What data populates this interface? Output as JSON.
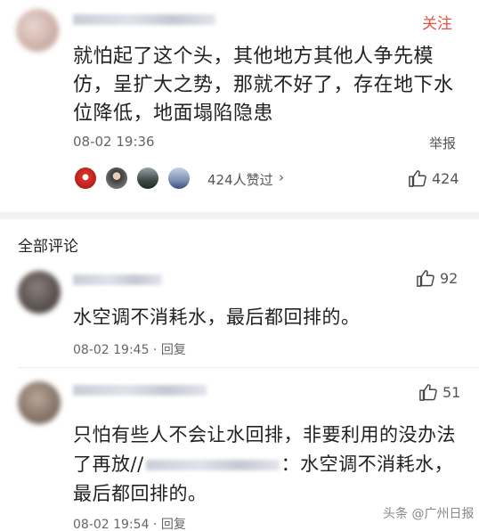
{
  "top_comment": {
    "follow_label": "关注",
    "text": "就怕起了这个头，其他地方其他人争先模仿，呈扩大之势，那就不好了，存在地下水位降低，地面塌陷隐患",
    "time": "08-02 19:36",
    "report_label": "举报",
    "likers_label": "424人赞过",
    "chevron": "›",
    "like_count": "424"
  },
  "section_title": "全部评论",
  "replies": [
    {
      "text": "水空调不消耗水，最后都回排的。",
      "meta": "08-02 19:45 · 回复",
      "likes": "92"
    },
    {
      "text_part1": "只怕有些人不会让水回排，非要利用的没办法了再放//",
      "text_part2": "：水空调不消耗水，最后都回排的。",
      "meta": "08-02 19:54 · 回复",
      "likes": "51"
    }
  ],
  "watermark": "头条 @广州日报",
  "colors": {
    "accent": "#e8504a",
    "divider": "#f2f2f2",
    "secondary_text": "#666666"
  }
}
